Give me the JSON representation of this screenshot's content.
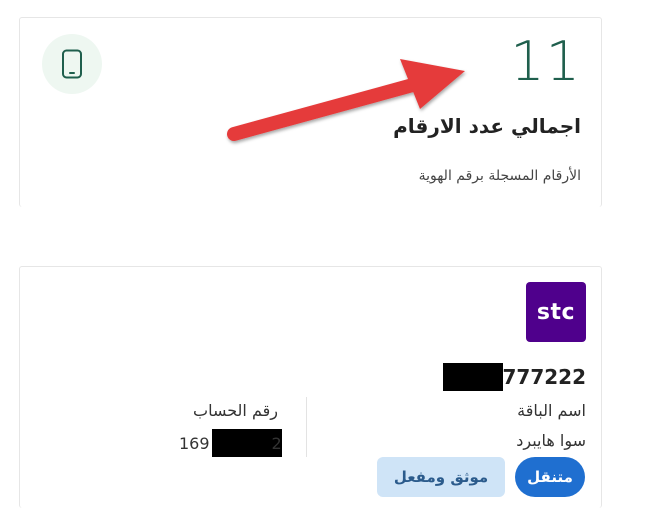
{
  "summary": {
    "count": "11",
    "title": "اجمالي عدد الارقام",
    "subtitle": "الأرقام المسجلة برقم الهوية",
    "icon": "mobile-phone-icon",
    "accent_color": "#1f5f4d",
    "icon_bg": "#eef7f1"
  },
  "annotation": {
    "arrow_color": "#e53b3b"
  },
  "line": {
    "operator_logo": "stc",
    "logo_color": "#4f008c",
    "number_visible": "777222",
    "plan_label": "اسم الباقة",
    "plan_value": "سوا هايبرد",
    "account_label": "رقم الحساب",
    "account_value_prefix": "169",
    "account_value_suffix": "2",
    "status_badges": {
      "roaming": "متنقل",
      "verified": "موثق ومفعل"
    }
  }
}
